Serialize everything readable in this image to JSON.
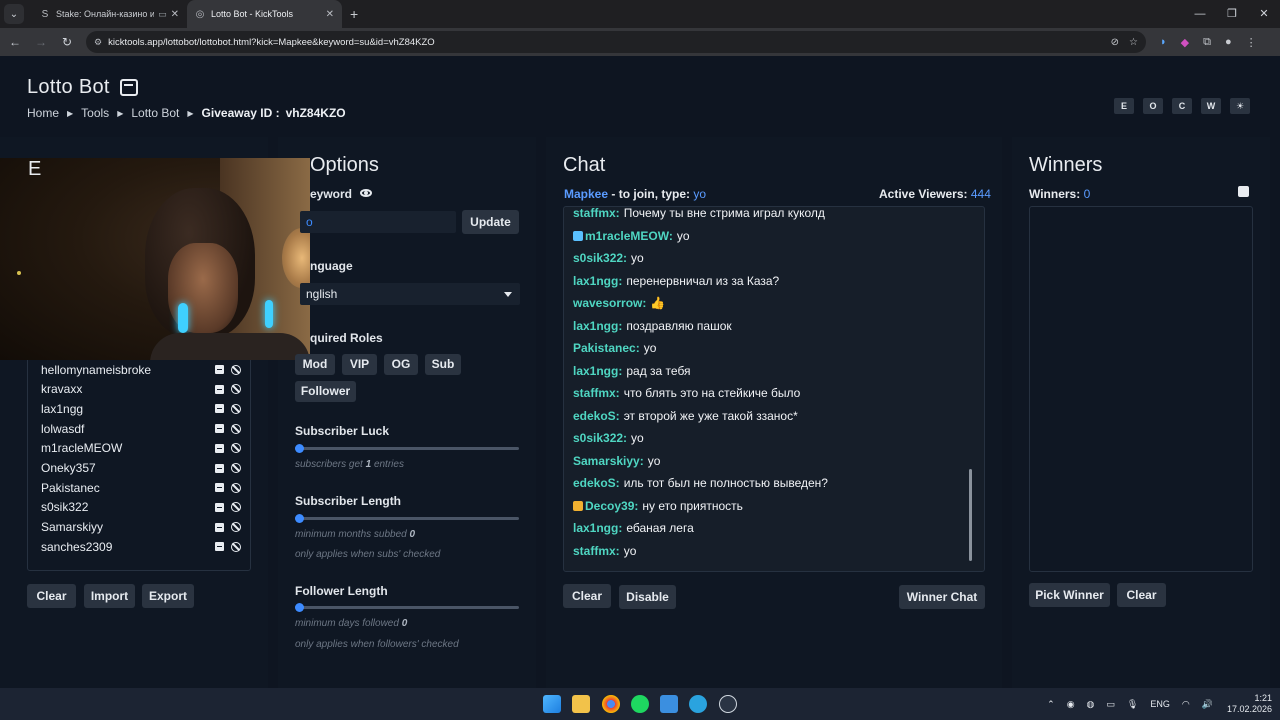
{
  "browser": {
    "tabs": [
      {
        "title": "Stake: Онлайн-казино и ст",
        "favicon": "stake-s-icon"
      },
      {
        "title": "Lotto Bot - KickTools",
        "favicon": "globe-icon"
      }
    ],
    "url": "kicktools.app/lottobot/lottobot.html?kick=Mapkee&keyword=su&id=vhZ84KZO"
  },
  "page": {
    "title": "Lotto Bot",
    "breadcrumb": [
      "Home",
      "Tools",
      "Lotto Bot"
    ],
    "giveaway_label": "Giveaway ID :",
    "giveaway_id": "vhZ84KZO",
    "mode_buttons": [
      "E",
      "O",
      "C",
      "W",
      "☀"
    ]
  },
  "entries": {
    "title_visible_char": "E",
    "items": [
      "hellomynameisbroke",
      "kravaxx",
      "lax1ngg",
      "lolwasdf",
      "m1racleMEOW",
      "Oneky357",
      "Pakistanec",
      "s0sik322",
      "Samarskiyy",
      "sanches2309"
    ],
    "buttons": {
      "clear": "Clear",
      "import": "Import",
      "export": "Export"
    }
  },
  "options": {
    "title": "Options",
    "keyword_label": "eyword",
    "keyword_value": "o",
    "update_label": "Update",
    "language_label": "nguage",
    "language_value": "nglish",
    "roles_label": "quired Roles",
    "roles": [
      "Mod",
      "VIP",
      "OG",
      "Sub",
      "Follower"
    ],
    "sub_luck": {
      "label": "Subscriber Luck",
      "hint_pre": "subscribers get",
      "hint_val": "1",
      "hint_post": "entries",
      "value": 1
    },
    "sub_length": {
      "label": "Subscriber Length",
      "hint_pre": "minimum months subbed",
      "hint_val": "0",
      "note": "only applies when subs' checked",
      "value": 0
    },
    "fol_length": {
      "label": "Follower Length",
      "hint_pre": "minimum days followed",
      "hint_val": "0",
      "note": "only applies when followers' checked",
      "value": 0
    }
  },
  "chat": {
    "title": "Chat",
    "channel": "Mapkee",
    "join_text": "- to join, type:",
    "keyword": "yo",
    "viewers_label": "Active Viewers:",
    "viewers": "444",
    "messages": [
      {
        "user": "staffmx:",
        "text": "Почему ты вне стрима играл куколд"
      },
      {
        "user": "m1racleMEOW:",
        "text": "yo",
        "badge": "#5ac0ff"
      },
      {
        "user": "s0sik322:",
        "text": "yo"
      },
      {
        "user": "lax1ngg:",
        "text": "перенервничал из за Каза?"
      },
      {
        "user": "wavesorrow:",
        "text": "👍"
      },
      {
        "user": "lax1ngg:",
        "text": "поздравляю пашок"
      },
      {
        "user": "Pakistanec:",
        "text": "yo"
      },
      {
        "user": "lax1ngg:",
        "text": "рад за тебя"
      },
      {
        "user": "staffmx:",
        "text": "что блять это на стейкиче было"
      },
      {
        "user": "edekoS:",
        "text": "эт второй же уже такой ззанос*"
      },
      {
        "user": "s0sik322:",
        "text": "yo"
      },
      {
        "user": "Samarskiyy:",
        "text": "yo"
      },
      {
        "user": "edekoS:",
        "text": "иль тот был не полностью выведен?"
      },
      {
        "user": "Decoy39:",
        "text": "ну ето приятность",
        "badge": "#f0b030"
      },
      {
        "user": "lax1ngg:",
        "text": "ебаная лега"
      },
      {
        "user": "staffmx:",
        "text": "yo"
      }
    ],
    "buttons": {
      "clear": "Clear",
      "disable": "Disable",
      "winner_chat": "Winner Chat"
    }
  },
  "winners": {
    "title": "Winners",
    "count_label": "Winners:",
    "count": "0",
    "buttons": {
      "pick": "Pick Winner",
      "clear": "Clear"
    }
  },
  "taskbar": {
    "lang": "ENG",
    "time": "1:21",
    "date": "17.02.2026"
  },
  "colors": {
    "accent": "#3d8bff",
    "username": "#4fd6c2",
    "button_bg": "#2a3340"
  }
}
